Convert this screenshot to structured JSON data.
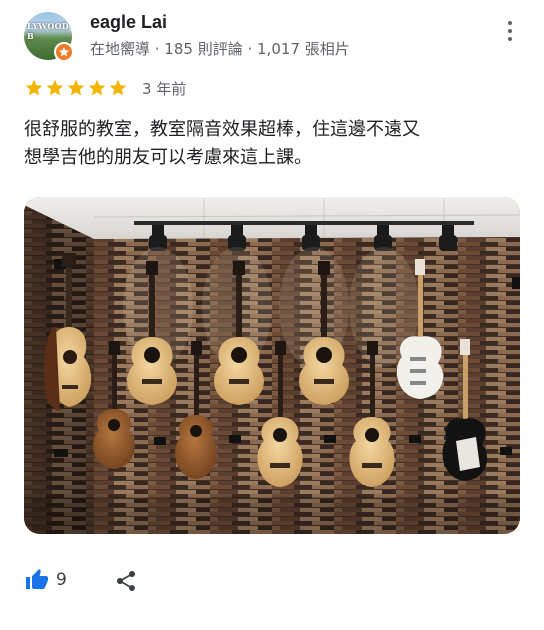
{
  "review": {
    "author": {
      "name": "eagle Lai",
      "meta": "在地嚮導 · 185 則評論 · 1,017 張相片",
      "avatar_text": "LYWOOD B",
      "badge_icon": "local-guide-star-icon"
    },
    "rating": 5,
    "date": "3 年前",
    "text_lines": [
      "很舒服的教室，教室隔音效果超棒，住這邊不遠又",
      "想學吉他的朋友可以考慮來這上課。"
    ],
    "photo": {
      "subject": "guitars-on-wood-wall-photo"
    },
    "likes": "9"
  },
  "colors": {
    "star": "#f4b400",
    "like": "#1a73e8",
    "badge": "#f07a25"
  }
}
